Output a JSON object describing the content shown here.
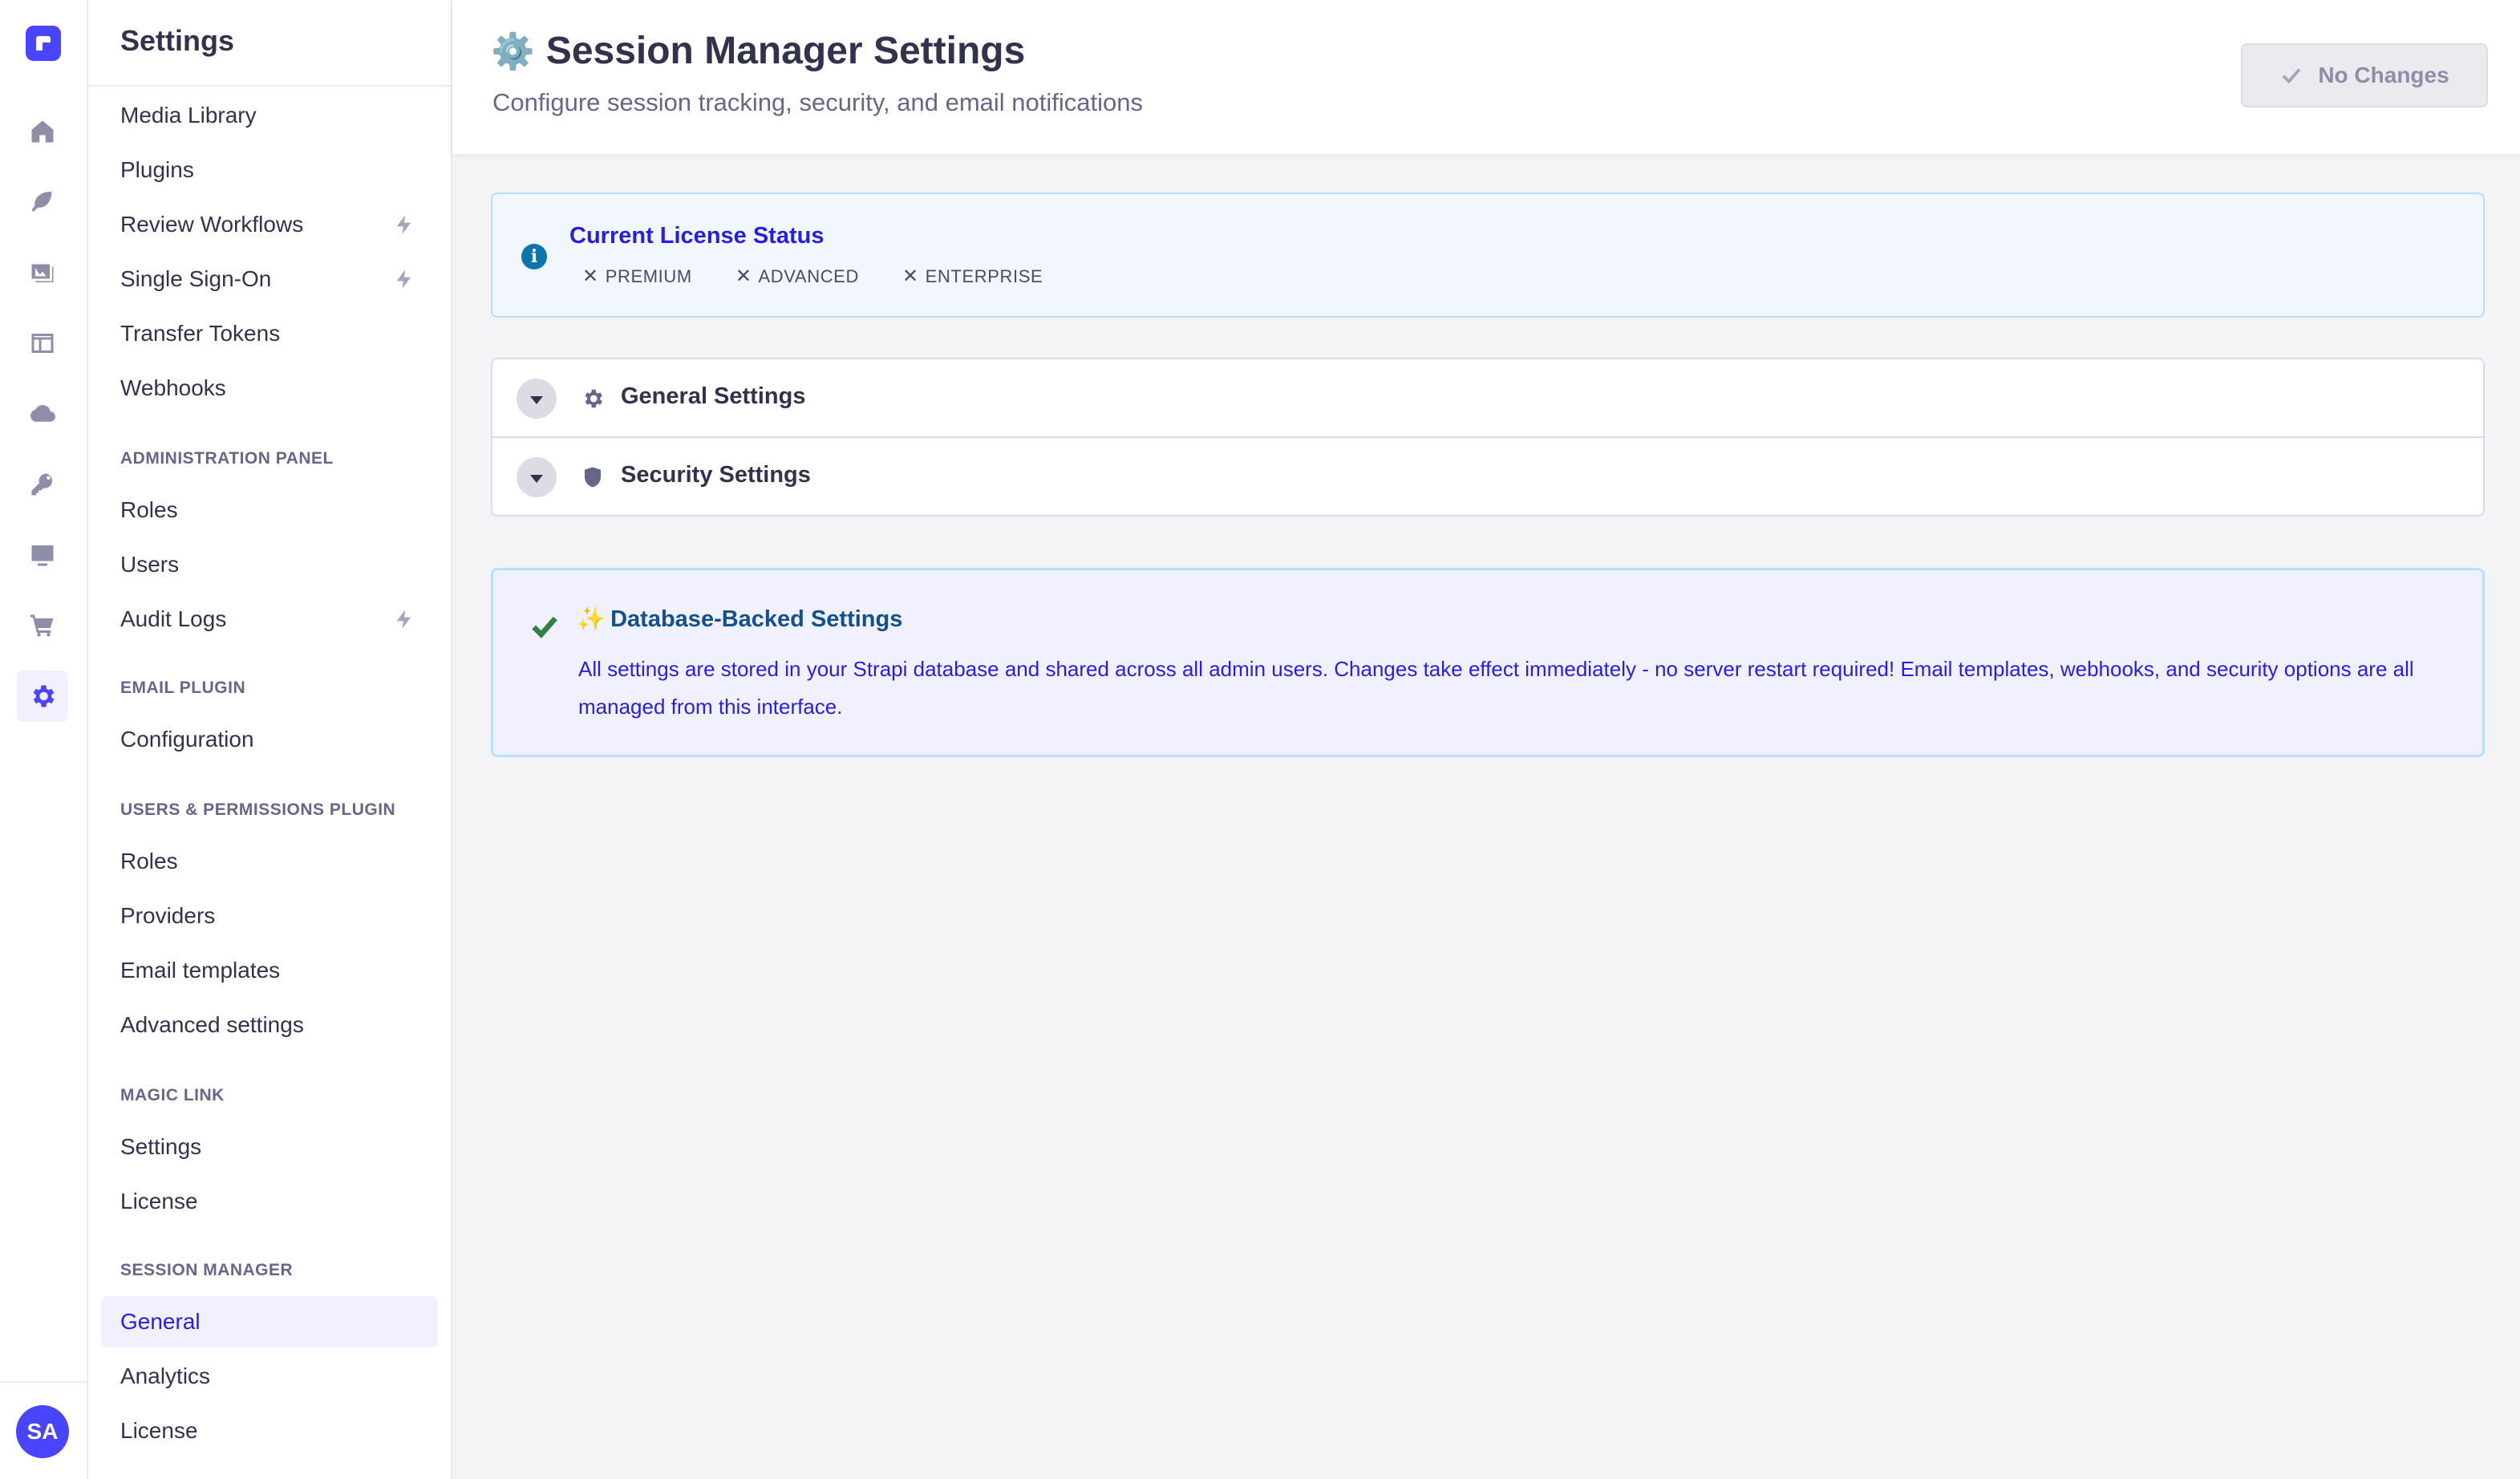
{
  "rail": {
    "avatar_initials": "SA",
    "icons": [
      "home-icon",
      "feather-icon",
      "image-icon",
      "layout-icon",
      "cloud-icon",
      "key-icon",
      "monitor-icon",
      "cart-icon",
      "settings-icon"
    ]
  },
  "sidebar": {
    "title": "Settings",
    "items_top": [
      "Media Library",
      "Plugins",
      "Review Workflows",
      "Single Sign-On",
      "Transfer Tokens",
      "Webhooks"
    ],
    "sections": [
      {
        "label": "ADMINISTRATION PANEL",
        "items": [
          "Roles",
          "Users",
          "Audit Logs"
        ]
      },
      {
        "label": "EMAIL PLUGIN",
        "items": [
          "Configuration"
        ]
      },
      {
        "label": "USERS & PERMISSIONS PLUGIN",
        "items": [
          "Roles",
          "Providers",
          "Email templates",
          "Advanced settings"
        ]
      },
      {
        "label": "MAGIC LINK",
        "items": [
          "Settings",
          "License"
        ]
      },
      {
        "label": "SESSION MANAGER",
        "items": [
          "General",
          "Analytics",
          "License"
        ]
      }
    ]
  },
  "header": {
    "emoji": "⚙️",
    "title": "Session Manager Settings",
    "subtitle": "Configure session tracking, security, and email notifications",
    "button_label": "No Changes"
  },
  "license": {
    "title": "Current License Status",
    "tags": [
      "PREMIUM",
      "ADVANCED",
      "ENTERPRISE"
    ]
  },
  "accordions": [
    {
      "label": "General Settings",
      "icon": "gear-icon"
    },
    {
      "label": "Security Settings",
      "icon": "shield-icon"
    }
  ],
  "db_card": {
    "spark": "✨",
    "title": "Database-Backed Settings",
    "body": "All settings are stored in your Strapi database and shared across all admin users. Changes take effect immediately - no server restart required! Email templates, webhooks, and security options are all managed from this interface."
  },
  "colors": {
    "accent": "#4945ff",
    "active_text": "#271fe0",
    "success": "#328048"
  }
}
